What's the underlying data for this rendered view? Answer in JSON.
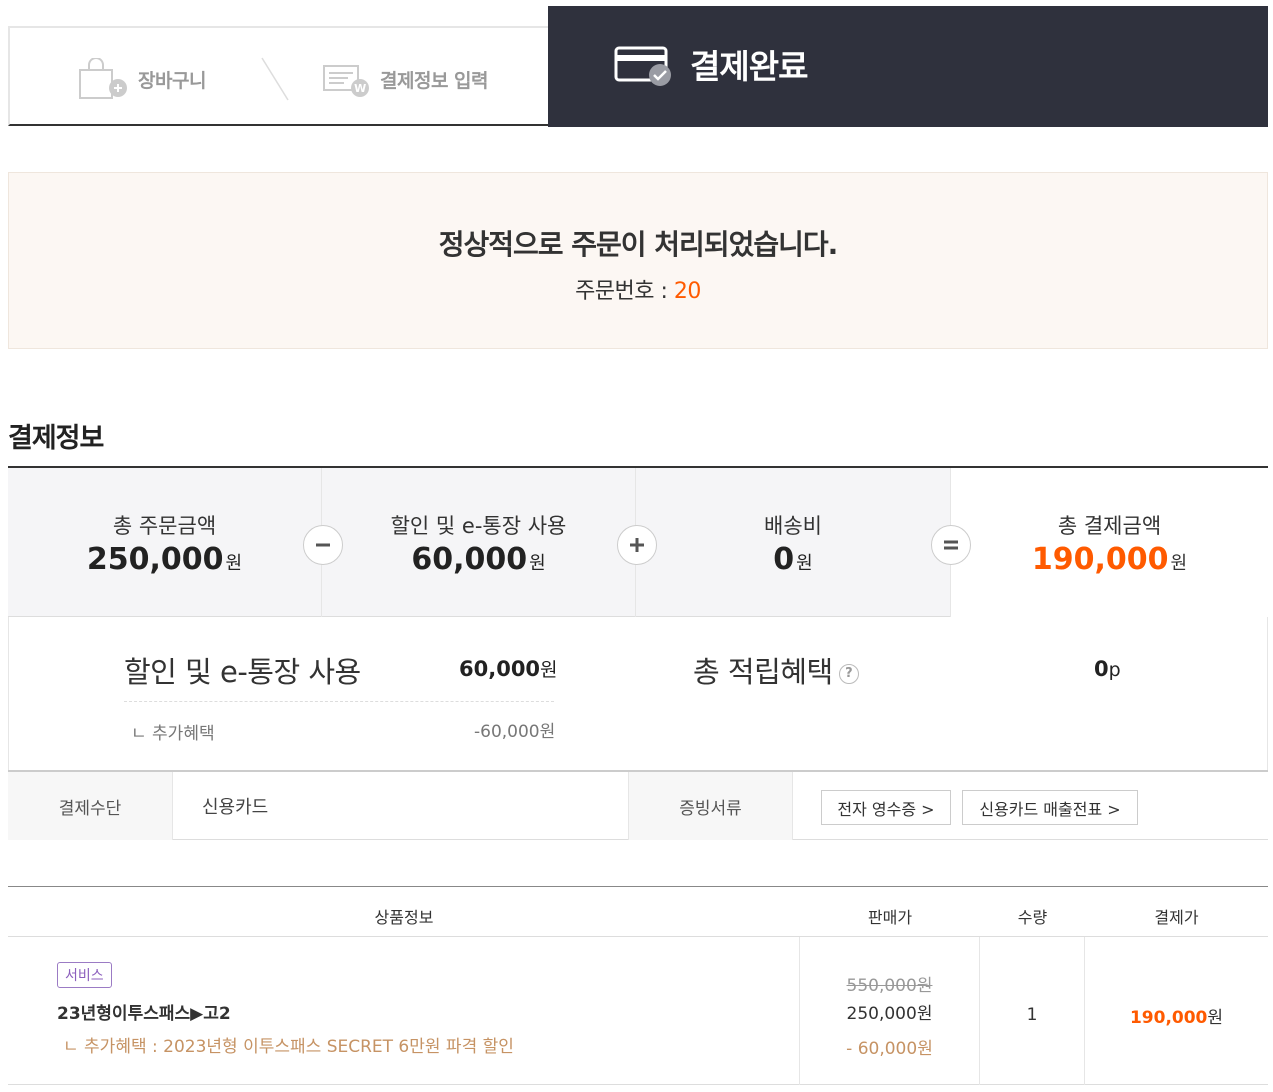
{
  "steps": {
    "cart_label": "장바구니",
    "payinfo_label": "결제정보 입력",
    "complete_label": "결제완료"
  },
  "completion": {
    "message": "정상적으로 주문이 처리되었습니다.",
    "order_label": "주문번호 : ",
    "order_number": "20"
  },
  "payment_section": {
    "title": "결제정보",
    "summary": {
      "total_order_label": "총 주문금액",
      "total_order_value": "250,000",
      "discount_label": "할인 및 e-통장 사용",
      "discount_value": "60,000",
      "shipping_label": "배송비",
      "shipping_value": "0",
      "total_pay_label": "총 결제금액",
      "total_pay_value": "190,000",
      "currency": "원"
    },
    "detail": {
      "discount_label": "할인 및 e-통장 사용",
      "discount_value": "60,000",
      "extra_label": "ㄴ 추가혜택",
      "extra_value": "-60,000원",
      "points_label": "총 적립혜택",
      "points_value": "0",
      "points_unit": "p",
      "help": "?"
    },
    "method": {
      "method_label": "결제수단",
      "method_value": "신용카드",
      "docs_label": "증빙서류",
      "receipt_button": "전자 영수증 >",
      "card_slip_button": "신용카드 매출전표 >"
    }
  },
  "products": {
    "headers": {
      "info": "상품정보",
      "price": "판매가",
      "qty": "수량",
      "pay": "결제가"
    },
    "rows": [
      {
        "badge": "서비스",
        "name": "23년형이투스패스▶고2",
        "benefit": "ㄴ 추가혜택 : 2023년형 이투스패스 SECRET 6만원 파격 할인",
        "original_price": "550,000",
        "sale_price": "250,000",
        "discount": "- 60,000",
        "qty": "1",
        "final_price": "190,000",
        "currency": "원"
      }
    ]
  },
  "colors": {
    "accent": "#ff5a00",
    "dark_header": "#2f313d",
    "done_bg": "#fcf7f3",
    "benefit": "#c69364",
    "badge": "#8c5fbd"
  }
}
